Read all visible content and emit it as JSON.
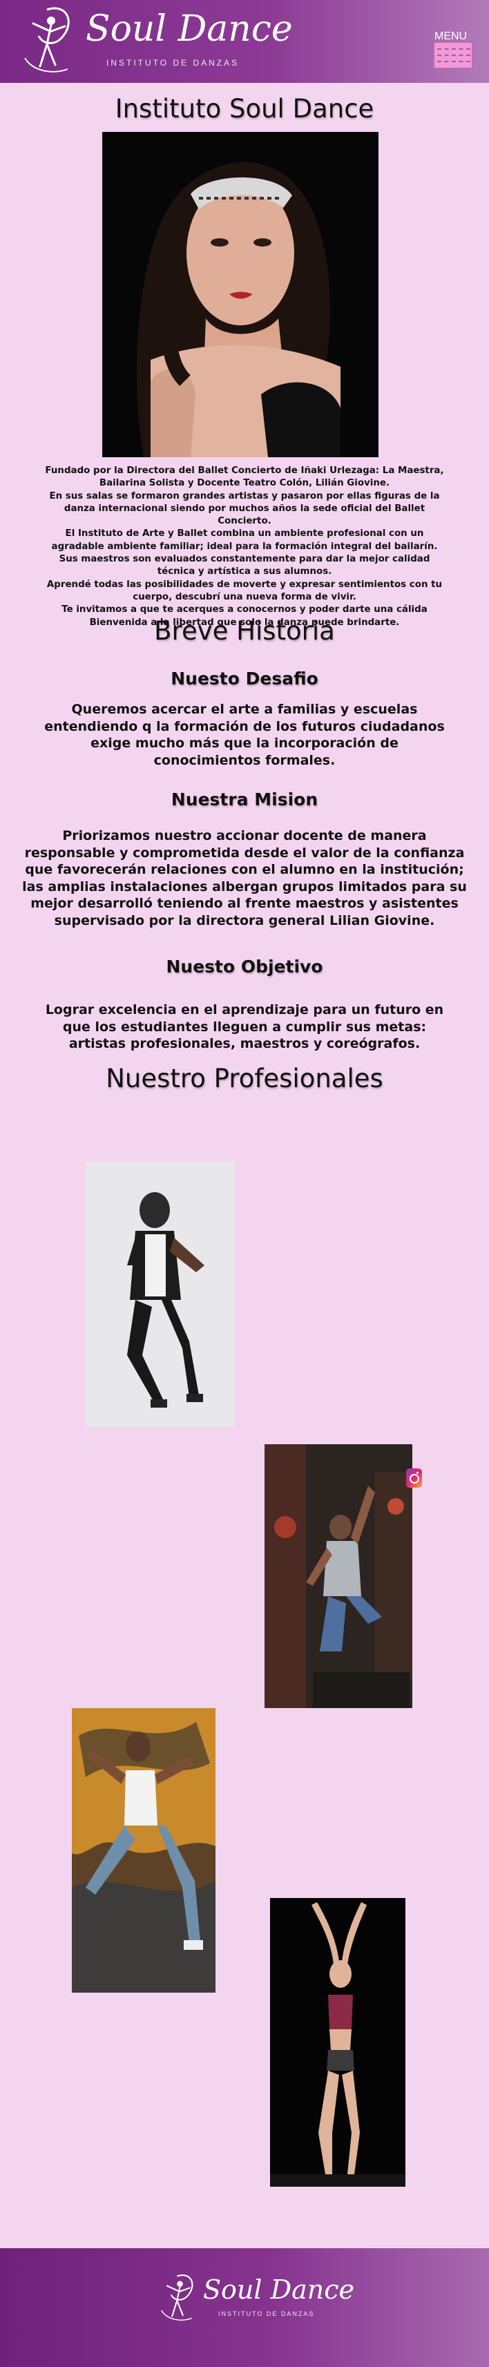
{
  "header": {
    "logo_text": "Soul Dance",
    "logo_subtitle": "INSTITUTO DE DANZAS",
    "menu_label": "MENU"
  },
  "page_title": "Instituto Soul Dance",
  "intro": {
    "paragraphs": [
      "Fundado por la Directora del Ballet Concierto de Iñaki Urlezaga: La Maestra, Bailarina Solista y Docente Teatro Colón, Lilián Giovine.",
      "En sus salas se formaron grandes artistas y pasaron por ellas figuras de la danza internacional siendo por muchos años la sede oficial del Ballet Concierto.",
      "El Instituto de Arte y Ballet combina un ambiente profesional con un agradable ambiente familiar; ideal para la formación integral del bailarín.",
      "Sus maestros son evaluados constantemente para dar la mejor calidad técnica y artística a sus alumnos.",
      "Aprendé todas las posibilidades de moverte y expresar sentimientos con tu cuerpo, descubrí una nueva forma de vivir.",
      "Te invitamos a que te acerques a conocernos y poder darte una cálida Bienvenida a la libertad que solo la danza puede brindarte."
    ]
  },
  "history": {
    "title": "Breve Historia",
    "challenge_title": "Nuesto Desafio",
    "challenge_text": "Queremos acercar el arte a familias y escuelas entendiendo q la formación de los futuros ciudadanos exige mucho más que la incorporación de conocimientos formales.",
    "mission_title": "Nuestra Mision",
    "mission_text": "Priorizamos nuestro accionar docente de manera responsable y comprometida desde el valor de la confianza que favorecerán relaciones con el alumno en la institución; las amplias instalaciones albergan grupos limitados para su mejor desarrolló teniendo al frente maestros y asistentes supervisado por la directora general Lilian Giovine.",
    "objective_title": "Nuesto Objetivo",
    "objective_text": "Lograr excelencia en el aprendizaje para un futuro en que los estudiantes lleguen a cumplir sus metas: artistas profesionales, maestros y coreógrafos."
  },
  "professionals": {
    "title": "Nuestro Profesionales"
  },
  "footer": {
    "logo_text": "Soul Dance",
    "logo_subtitle": "INSTITUTO DE DANZAS"
  },
  "colors": {
    "background": "#f4d5ef",
    "header_purple": "#7a2a86",
    "menu_pink": "#f19ad9"
  },
  "icons": {
    "header_logo": "dancer-logo-icon",
    "menu": "hamburger-menu-icon",
    "social": "instagram-icon"
  }
}
